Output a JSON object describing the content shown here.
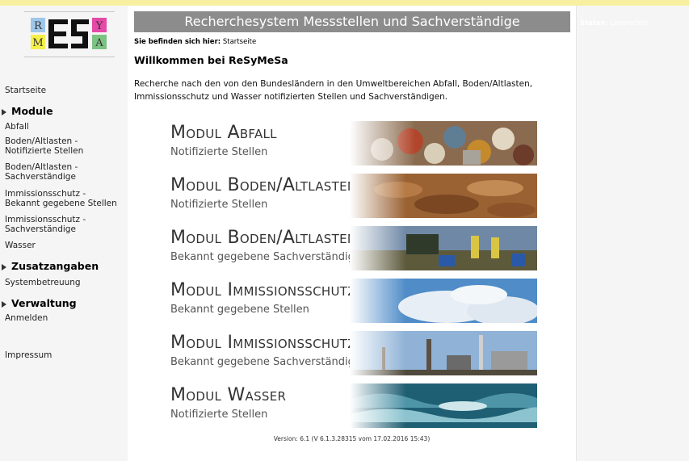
{
  "logo": {
    "letters": [
      "R",
      "E",
      "S",
      "Y",
      "M",
      "E",
      "S",
      "A"
    ]
  },
  "nav": {
    "startseite": "Startseite",
    "modules_head": "Module",
    "modules": [
      {
        "label1": "Abfall",
        "label2": ""
      },
      {
        "label1": "Boden/Altlasten -",
        "label2": "Notifizierte Stellen"
      },
      {
        "label1": "Boden/Altlasten -",
        "label2": "Sachverständige"
      },
      {
        "label1": "Immissionsschutz -",
        "label2": "Bekannt gegebene Stellen"
      },
      {
        "label1": "Immissionsschutz -",
        "label2": "Sachverständige"
      },
      {
        "label1": "Wasser",
        "label2": ""
      }
    ],
    "zusatz_head": "Zusatzangaben",
    "systembetreuung": "Systembetreuung",
    "verwaltung_head": "Verwaltung",
    "anmelden": "Anmelden",
    "impressum": "Impressum"
  },
  "header": {
    "title": "Recherchesystem Messstellen und Sachverständige",
    "breadcrumb_label": "Sie befinden sich hier:",
    "breadcrumb_value": "Startseite",
    "welcome": "Willkommen bei ReSyMeSa",
    "intro": "Recherche nach den von den Bundesländern in den Umweltbereichen Abfall, Boden/Altlasten, Immissionsschutz und Wasser notifizierten Stellen und Sachverständigen."
  },
  "status": {
    "label": "Status:",
    "value": "Leserechte"
  },
  "modules": [
    {
      "title": "Modul Abfall",
      "subtitle": "Notifizierte Stellen",
      "image": "waste-cans-image"
    },
    {
      "title": "Modul Boden/Altlasten",
      "subtitle": "Notifizierte Stellen",
      "image": "soil-image"
    },
    {
      "title": "Modul Boden/Altlasten",
      "subtitle": "Bekannt gegebene Sachverständige",
      "image": "contamination-site-image"
    },
    {
      "title": "Modul Immissionsschutz",
      "subtitle": "Bekannt gegebene Stellen",
      "image": "sky-clouds-image"
    },
    {
      "title": "Modul Immissionsschutz",
      "subtitle": "Bekannt gegebene Sachverständige",
      "image": "industry-chimney-image"
    },
    {
      "title": "Modul Wasser",
      "subtitle": "Notifizierte Stellen",
      "image": "water-waves-image"
    }
  ],
  "version": "Version: 6.1 (V 6.1.3.28315 vom 17.02.2016 15:43)",
  "colors": {
    "header_bg": "#8c8c8c",
    "page_bg": "#f5f5f5",
    "top_strip": "#f7f0a0"
  }
}
